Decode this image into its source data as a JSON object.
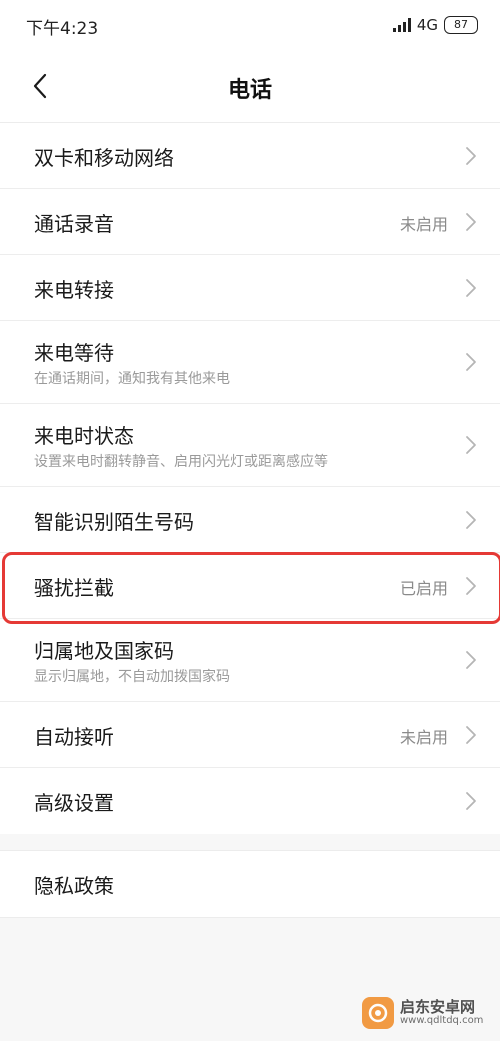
{
  "status_bar": {
    "time": "下午4:23",
    "network": "4G",
    "battery": "87"
  },
  "header": {
    "title": "电话"
  },
  "settings": [
    {
      "title": "双卡和移动网络",
      "subtitle": "",
      "status": ""
    },
    {
      "title": "通话录音",
      "subtitle": "",
      "status": "未启用"
    },
    {
      "title": "来电转接",
      "subtitle": "",
      "status": ""
    },
    {
      "title": "来电等待",
      "subtitle": "在通话期间，通知我有其他来电",
      "status": ""
    },
    {
      "title": "来电时状态",
      "subtitle": "设置来电时翻转静音、启用闪光灯或距离感应等",
      "status": ""
    },
    {
      "title": "智能识别陌生号码",
      "subtitle": "",
      "status": ""
    },
    {
      "title": "骚扰拦截",
      "subtitle": "",
      "status": "已启用"
    },
    {
      "title": "归属地及国家码",
      "subtitle": "显示归属地，不自动加拨国家码",
      "status": ""
    },
    {
      "title": "自动接听",
      "subtitle": "",
      "status": "未启用"
    },
    {
      "title": "高级设置",
      "subtitle": "",
      "status": ""
    }
  ],
  "privacy": {
    "title": "隐私政策"
  },
  "watermark": {
    "name": "启东安卓网",
    "url": "www.qdltdq.com"
  },
  "colors": {
    "highlight": "#e53935",
    "background": "#f7f7f7"
  },
  "icons": {
    "back": "back-arrow-icon",
    "row": "chevron-right-icon"
  }
}
